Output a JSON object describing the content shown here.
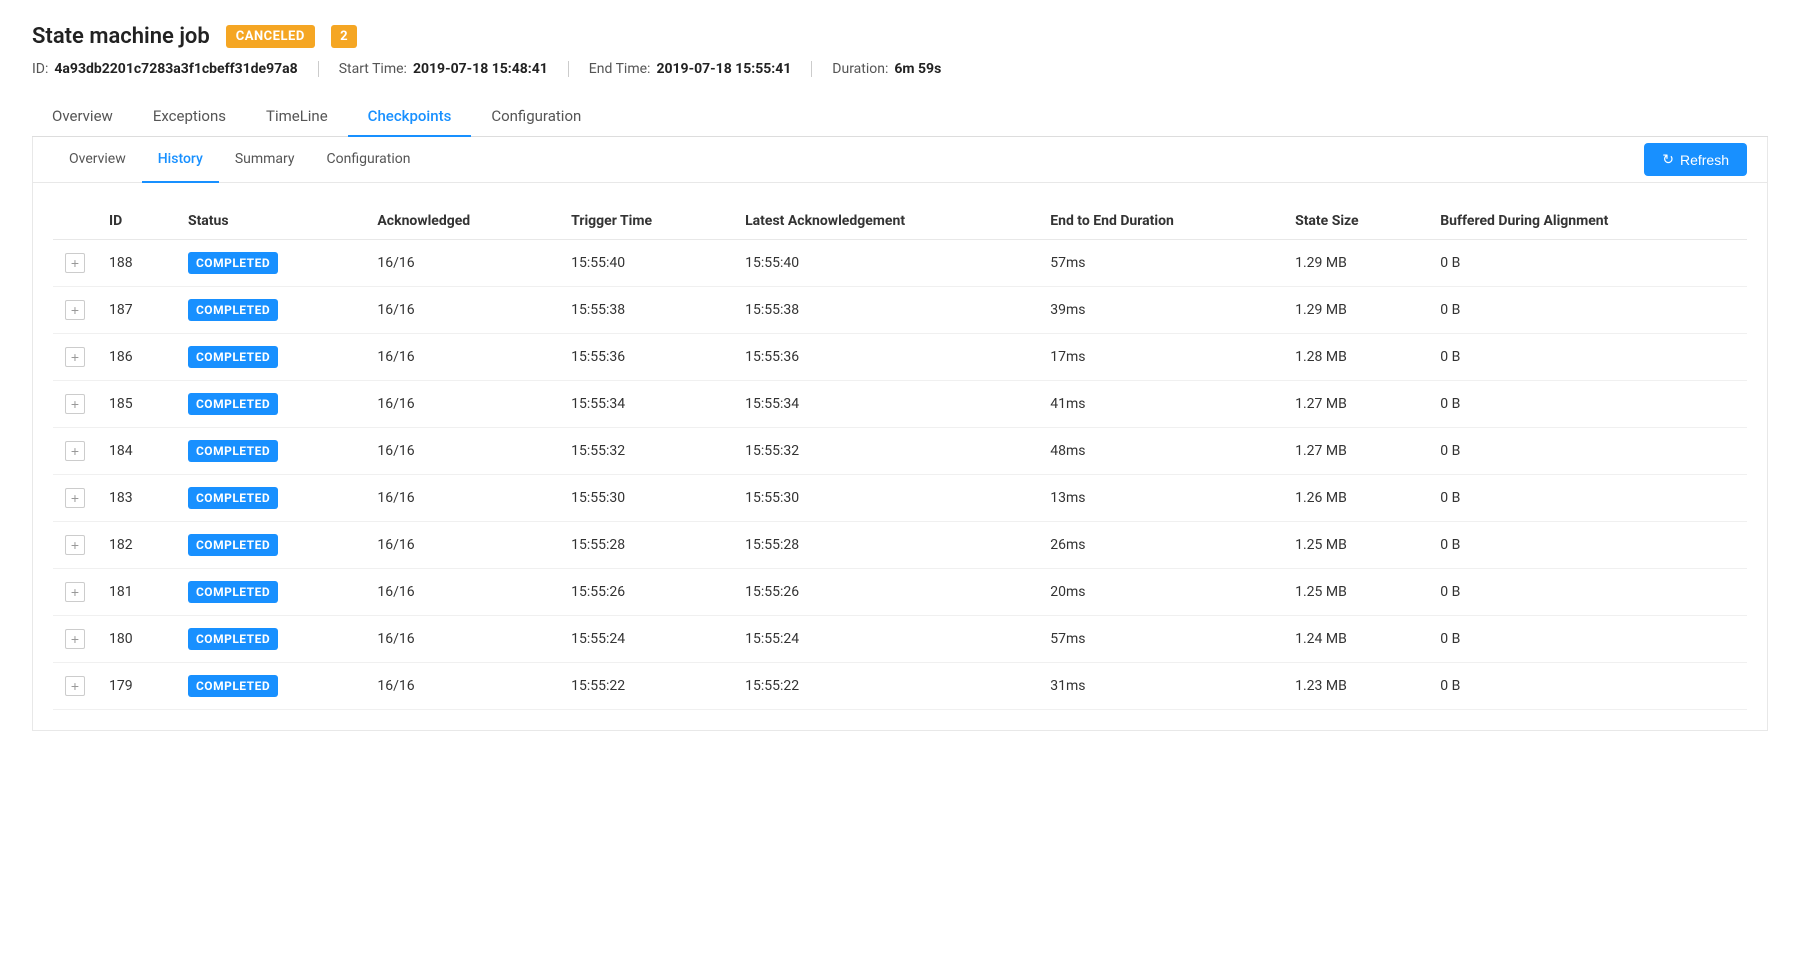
{
  "header": {
    "title": "State machine job",
    "badge_canceled": "CANCELED",
    "badge_number": "2",
    "id_label": "ID:",
    "id_value": "4a93db2201c7283a3f1cbeff31de97a8",
    "start_time_label": "Start Time:",
    "start_time_value": "2019-07-18 15:48:41",
    "end_time_label": "End Time:",
    "end_time_value": "2019-07-18 15:55:41",
    "duration_label": "Duration:",
    "duration_value": "6m 59s"
  },
  "top_tabs": [
    {
      "label": "Overview",
      "active": false
    },
    {
      "label": "Exceptions",
      "active": false
    },
    {
      "label": "TimeLine",
      "active": false
    },
    {
      "label": "Checkpoints",
      "active": true
    },
    {
      "label": "Configuration",
      "active": false
    }
  ],
  "inner_tabs": [
    {
      "label": "Overview",
      "active": false
    },
    {
      "label": "History",
      "active": true
    },
    {
      "label": "Summary",
      "active": false
    },
    {
      "label": "Configuration",
      "active": false
    }
  ],
  "refresh_button": "Refresh",
  "table": {
    "columns": [
      "",
      "ID",
      "Status",
      "Acknowledged",
      "Trigger Time",
      "Latest Acknowledgement",
      "End to End Duration",
      "State Size",
      "Buffered During Alignment"
    ],
    "rows": [
      {
        "id": "188",
        "status": "COMPLETED",
        "acknowledged": "16/16",
        "trigger_time": "15:55:40",
        "latest_ack": "15:55:40",
        "duration": "57ms",
        "state_size": "1.29 MB",
        "buffered": "0 B"
      },
      {
        "id": "187",
        "status": "COMPLETED",
        "acknowledged": "16/16",
        "trigger_time": "15:55:38",
        "latest_ack": "15:55:38",
        "duration": "39ms",
        "state_size": "1.29 MB",
        "buffered": "0 B"
      },
      {
        "id": "186",
        "status": "COMPLETED",
        "acknowledged": "16/16",
        "trigger_time": "15:55:36",
        "latest_ack": "15:55:36",
        "duration": "17ms",
        "state_size": "1.28 MB",
        "buffered": "0 B"
      },
      {
        "id": "185",
        "status": "COMPLETED",
        "acknowledged": "16/16",
        "trigger_time": "15:55:34",
        "latest_ack": "15:55:34",
        "duration": "41ms",
        "state_size": "1.27 MB",
        "buffered": "0 B"
      },
      {
        "id": "184",
        "status": "COMPLETED",
        "acknowledged": "16/16",
        "trigger_time": "15:55:32",
        "latest_ack": "15:55:32",
        "duration": "48ms",
        "state_size": "1.27 MB",
        "buffered": "0 B"
      },
      {
        "id": "183",
        "status": "COMPLETED",
        "acknowledged": "16/16",
        "trigger_time": "15:55:30",
        "latest_ack": "15:55:30",
        "duration": "13ms",
        "state_size": "1.26 MB",
        "buffered": "0 B"
      },
      {
        "id": "182",
        "status": "COMPLETED",
        "acknowledged": "16/16",
        "trigger_time": "15:55:28",
        "latest_ack": "15:55:28",
        "duration": "26ms",
        "state_size": "1.25 MB",
        "buffered": "0 B"
      },
      {
        "id": "181",
        "status": "COMPLETED",
        "acknowledged": "16/16",
        "trigger_time": "15:55:26",
        "latest_ack": "15:55:26",
        "duration": "20ms",
        "state_size": "1.25 MB",
        "buffered": "0 B"
      },
      {
        "id": "180",
        "status": "COMPLETED",
        "acknowledged": "16/16",
        "trigger_time": "15:55:24",
        "latest_ack": "15:55:24",
        "duration": "57ms",
        "state_size": "1.24 MB",
        "buffered": "0 B"
      },
      {
        "id": "179",
        "status": "COMPLETED",
        "acknowledged": "16/16",
        "trigger_time": "15:55:22",
        "latest_ack": "15:55:22",
        "duration": "31ms",
        "state_size": "1.23 MB",
        "buffered": "0 B"
      }
    ]
  }
}
